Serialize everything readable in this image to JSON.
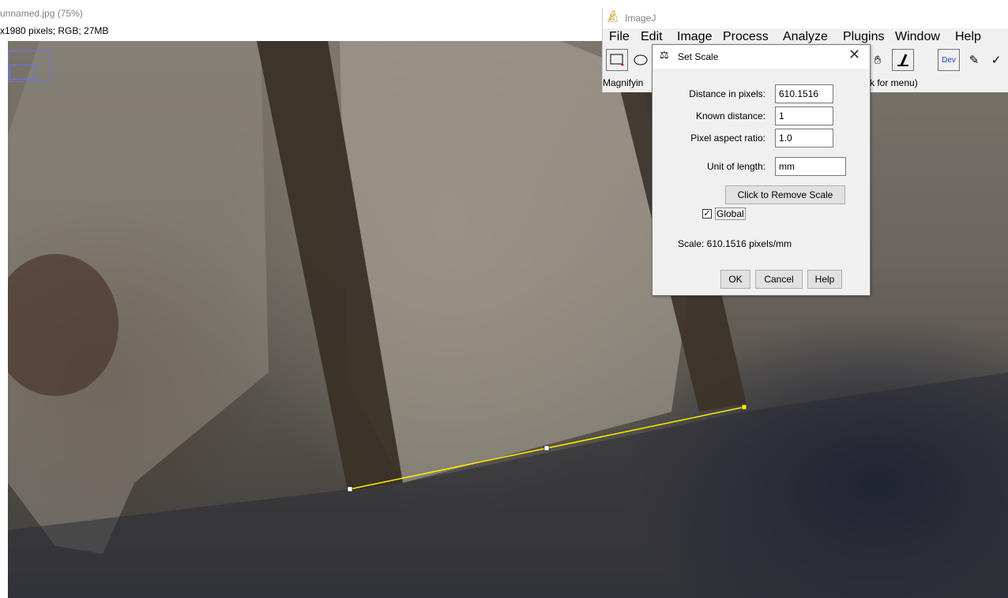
{
  "image_window": {
    "title": "unnamed.jpg (75%)",
    "info": "x1980 pixels; RGB; 27MB"
  },
  "imagej": {
    "title": "ImageJ",
    "menus": [
      "File",
      "Edit",
      "Image",
      "Process",
      "Analyze",
      "Plugins",
      "Window",
      "Help"
    ],
    "toolbar": {
      "tools": [
        "rectangle-tool",
        "oval-tool",
        "scroll-tool",
        "zoom-tool",
        "dev-menu",
        "brush-tool",
        "dropper-tool"
      ],
      "dev_label": "Dev"
    },
    "status_left": "Magnifyin",
    "status_right": "k for menu)"
  },
  "set_scale": {
    "title": "Set Scale",
    "fields": [
      {
        "label": "Distance in pixels:",
        "value": "610.1516"
      },
      {
        "label": "Known distance:",
        "value": "1"
      },
      {
        "label": "Pixel aspect ratio:",
        "value": "1.0"
      },
      {
        "label": "Unit of length:",
        "value": "mm"
      }
    ],
    "remove_scale_label": "Click to Remove Scale",
    "global_checked": true,
    "global_label": "Global",
    "scale_text": "Scale: 610.1516 pixels/mm",
    "ok_label": "OK",
    "cancel_label": "Cancel",
    "help_label": "Help"
  },
  "line_selection_color": "#ffee00"
}
